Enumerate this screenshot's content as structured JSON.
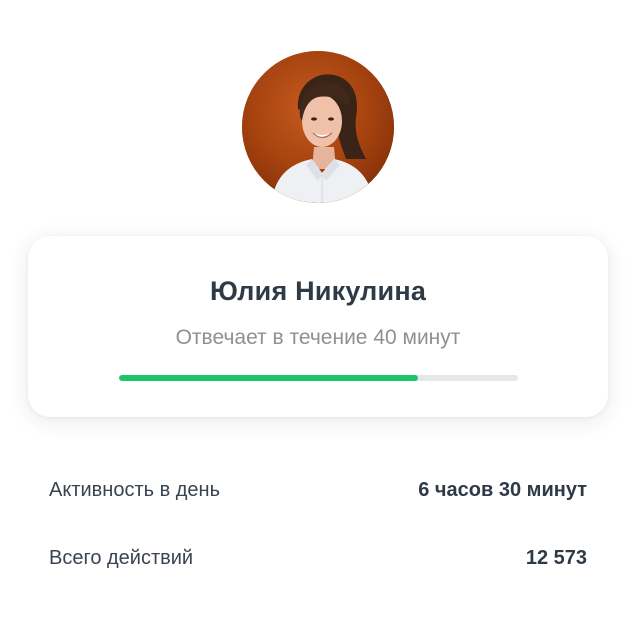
{
  "profile": {
    "name": "Юлия Никулина",
    "response_time": "Отвечает в течение 40 минут",
    "response_progress_percent": 75
  },
  "stats": [
    {
      "label": "Активность в день",
      "value": "6 часов 30 минут"
    },
    {
      "label": "Всего действий",
      "value": "12 573"
    }
  ],
  "colors": {
    "progress_fill": "#1ec46a",
    "progress_track": "#e6e7e9",
    "avatar_background": "#a3400f",
    "text_primary": "#2f3a47",
    "text_secondary": "#8c9196"
  }
}
